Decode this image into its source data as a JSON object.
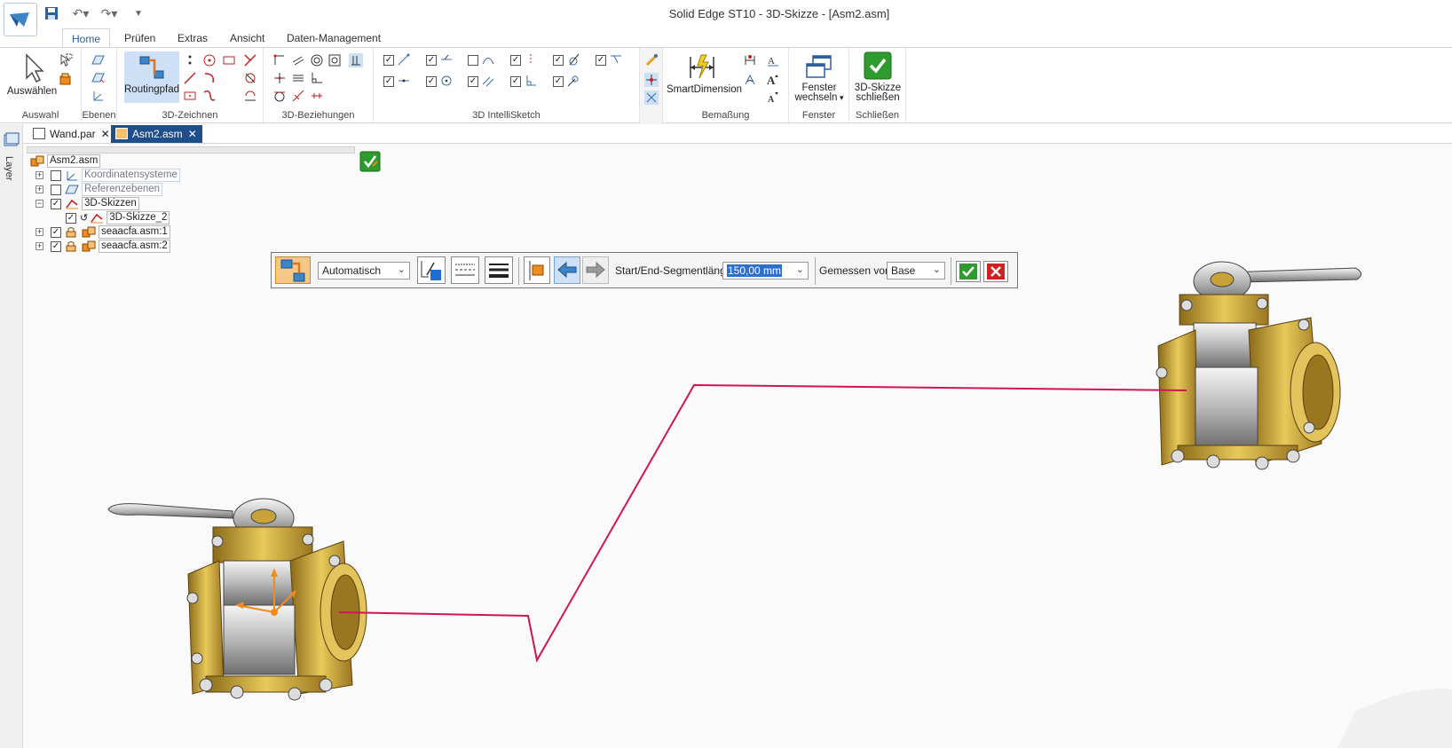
{
  "window": {
    "title": "Solid Edge ST10 - 3D-Skizze - [Asm2.asm]"
  },
  "tabs": [
    {
      "label": "Home",
      "active": true
    },
    {
      "label": "Prüfen"
    },
    {
      "label": "Extras"
    },
    {
      "label": "Ansicht"
    },
    {
      "label": "Daten-Management"
    }
  ],
  "ribbon": {
    "select_label": "Auswählen",
    "routing_label": "Routingpfad",
    "smartdim_label": "SmartDimension",
    "window_switch_line1": "Fenster",
    "window_switch_line2": "wechseln",
    "close_sketch_line1": "3D-Skizze",
    "close_sketch_line2": "schließen",
    "groups": {
      "auswahl": "Auswahl",
      "ebenen": "Ebenen",
      "zeichnen": "3D-Zeichnen",
      "beziehungen": "3D-Beziehungen",
      "intellisketch": "3D IntelliSketch",
      "bemassung": "Bemaßung",
      "fenster": "Fenster",
      "schliessen": "Schließen"
    }
  },
  "sidebar": {
    "layer_label": "Layer"
  },
  "doc_tabs": [
    {
      "label": "Wand.par",
      "active": false
    },
    {
      "label": "Asm2.asm",
      "active": true
    }
  ],
  "tree": {
    "root": "Asm2.asm",
    "items": [
      {
        "label": "Koordinatensysteme",
        "checked": false
      },
      {
        "label": "Referenzebenen",
        "checked": false
      },
      {
        "label": "3D-Skizzen",
        "checked": true
      },
      {
        "label": "3D-Skizze_2",
        "checked": true
      },
      {
        "label": "seaacfa.asm:1",
        "checked": true
      },
      {
        "label": "seaacfa.asm:2",
        "checked": true
      }
    ]
  },
  "command_bar": {
    "mode_value": "Automatisch",
    "segment_label": "Start/End-Segmentlänge:",
    "segment_value": "150,00 mm",
    "measured_label": "Gemessen von:",
    "measured_value": "Base"
  },
  "colors": {
    "accent": "#2a5fa6",
    "path": "#d1145a",
    "brass": "#c9a23a",
    "ok_green": "#2e9b2e",
    "cancel_red": "#d21f1f"
  }
}
